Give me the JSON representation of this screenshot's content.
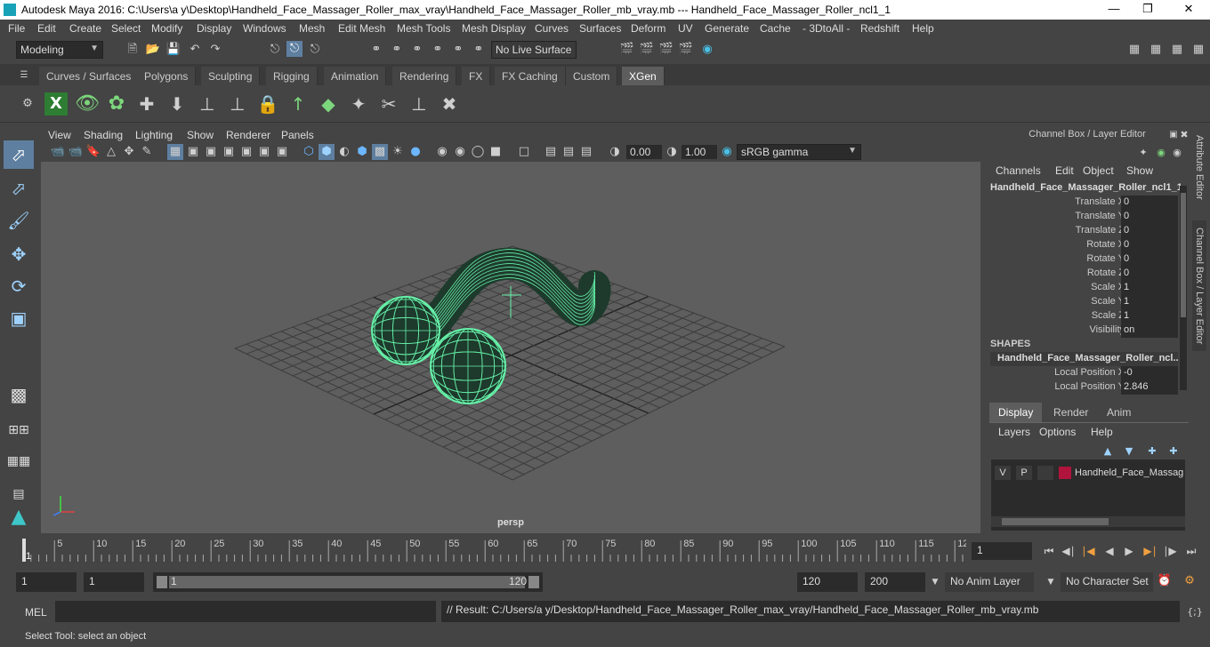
{
  "titlebar": {
    "title": "Autodesk Maya 2016: C:\\Users\\a y\\Desktop\\Handheld_Face_Massager_Roller_max_vray\\Handheld_Face_Massager_Roller_mb_vray.mb   ---   Handheld_Face_Massager_Roller_ncl1_1",
    "minimize": "—",
    "maximize": "❐",
    "close": "✕"
  },
  "menubar": [
    "File",
    "Edit",
    "Create",
    "Select",
    "Modify",
    "Display",
    "Windows",
    "Mesh",
    "Edit Mesh",
    "Mesh Tools",
    "Mesh Display",
    "Curves",
    "Surfaces",
    "Deform",
    "UV",
    "Generate",
    "Cache",
    "- 3DtoAll -",
    "Redshift",
    "Help"
  ],
  "statusline": {
    "mode": "Modeling",
    "live_surface": "No Live Surface"
  },
  "shelf_tabs": [
    "Curves / Surfaces",
    "Polygons",
    "Sculpting",
    "Rigging",
    "Animation",
    "Rendering",
    "FX",
    "FX Caching",
    "Custom",
    "XGen"
  ],
  "active_shelf": "XGen",
  "viewport": {
    "menu": [
      "View",
      "Shading",
      "Lighting",
      "Show",
      "Renderer",
      "Panels"
    ],
    "exposure": "0.00",
    "gamma": "1.00",
    "color_space": "sRGB gamma",
    "camera": "persp",
    "wire_color": "#66f0a8",
    "background": "#5e5e5e"
  },
  "channel_box": {
    "header": "Channel Box / Layer Editor",
    "menu": [
      "Channels",
      "Edit",
      "Object",
      "Show"
    ],
    "object": "Handheld_Face_Massager_Roller_ncl1_1",
    "attributes": [
      {
        "label": "Translate X",
        "value": "0"
      },
      {
        "label": "Translate Y",
        "value": "0"
      },
      {
        "label": "Translate Z",
        "value": "0"
      },
      {
        "label": "Rotate X",
        "value": "0"
      },
      {
        "label": "Rotate Y",
        "value": "0"
      },
      {
        "label": "Rotate Z",
        "value": "0"
      },
      {
        "label": "Scale X",
        "value": "1"
      },
      {
        "label": "Scale Y",
        "value": "1"
      },
      {
        "label": "Scale Z",
        "value": "1"
      },
      {
        "label": "Visibility",
        "value": "on"
      }
    ],
    "shapes_label": "SHAPES",
    "shape_name": "Handheld_Face_Massager_Roller_ncl...",
    "shape_attributes": [
      {
        "label": "Local Position X",
        "value": "-0"
      },
      {
        "label": "Local Position Y",
        "value": "2.846"
      }
    ]
  },
  "layer_editor": {
    "tabs": [
      "Display",
      "Render",
      "Anim"
    ],
    "active_tab": "Display",
    "menu": [
      "Layers",
      "Options",
      "Help"
    ],
    "layer": {
      "v": "V",
      "p": "P",
      "name": "Handheld_Face_Massager",
      "color": "#b0143c"
    }
  },
  "side_tabs": [
    "Attribute Editor",
    "Channel Box / Layer Editor"
  ],
  "timeline": {
    "ticks": [
      "1",
      "5",
      "10",
      "15",
      "20",
      "25",
      "30",
      "35",
      "40",
      "45",
      "50",
      "55",
      "60",
      "65",
      "70",
      "75",
      "80",
      "85",
      "90",
      "95",
      "100",
      "105",
      "110",
      "115",
      "12"
    ],
    "current_frame": "1"
  },
  "range": {
    "start": "1",
    "playback_start": "1",
    "slider_start": "1",
    "slider_end": "120",
    "playback_end": "120",
    "end": "200",
    "anim_layer": "No Anim Layer",
    "character_set": "No Character Set"
  },
  "command_line": {
    "label": "MEL",
    "result": "// Result: C:/Users/a y/Desktop/Handheld_Face_Massager_Roller_max_vray/Handheld_Face_Massager_Roller_mb_vray.mb"
  },
  "help_line": "Select Tool: select an object"
}
